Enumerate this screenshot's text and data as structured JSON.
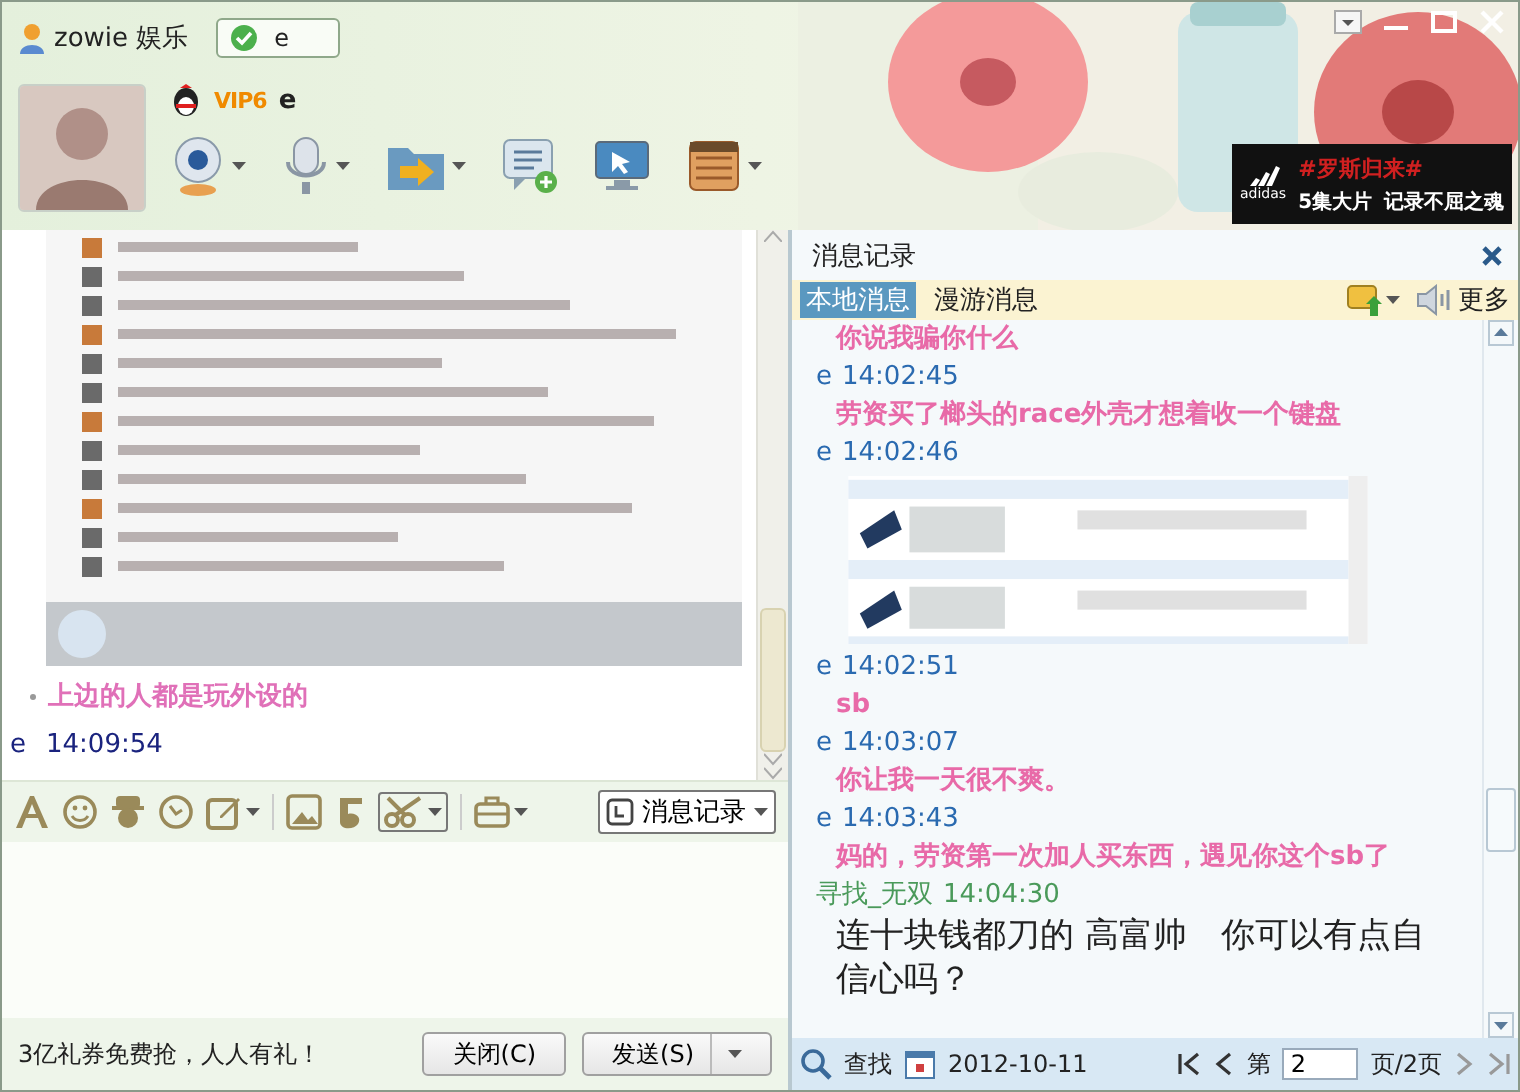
{
  "header": {
    "group_name": "zowie 娱乐",
    "status_tab": {
      "label": "e",
      "selected": true
    },
    "vip": "VIP6",
    "nickname": "e"
  },
  "ad": {
    "tag": "#罗斯归来#",
    "brand": "adidas",
    "line_1": "5集大片",
    "line_2": "记录不屈之魂"
  },
  "chat": {
    "messages": [
      {
        "kind": "picture"
      },
      {
        "kind": "text",
        "text": "上边的人都是玩外设的",
        "color": "#e070b8"
      },
      {
        "kind": "header",
        "sender": "e",
        "time": "14:09:54",
        "color": "#1a237e"
      }
    ]
  },
  "input_toolbar": {
    "history_button": "消息记录"
  },
  "footer": {
    "promo": "3亿礼券免费抢，人人有礼！",
    "buttons": [
      {
        "label": "关闭(C)",
        "kind": "plain"
      },
      {
        "label": "发送(S)",
        "kind": "split"
      }
    ]
  },
  "history": {
    "title": "消息记录",
    "tabs": [
      {
        "label": "本地消息",
        "selected": true
      },
      {
        "label": "漫游消息",
        "selected": false
      }
    ],
    "more": "更多",
    "entries": [
      {
        "kind": "text",
        "text": "你说我骗你什么",
        "color": "#e86aa8"
      },
      {
        "kind": "header",
        "sender": "e",
        "time": "14:02:45",
        "color": "#2a6ab0"
      },
      {
        "kind": "text",
        "text": "劳资买了榔头的race外壳才想着收一个键盘",
        "color": "#e86aa8"
      },
      {
        "kind": "header",
        "sender": "e",
        "time": "14:02:46",
        "color": "#2a6ab0"
      },
      {
        "kind": "picture"
      },
      {
        "kind": "header",
        "sender": "e",
        "time": "14:02:51",
        "color": "#2a6ab0"
      },
      {
        "kind": "text",
        "text": "sb",
        "color": "#e86aa8"
      },
      {
        "kind": "header",
        "sender": "e",
        "time": "14:03:07",
        "color": "#2a6ab0"
      },
      {
        "kind": "text",
        "text": "你让我一天很不爽。",
        "color": "#e86aa8"
      },
      {
        "kind": "header",
        "sender": "e",
        "time": "14:03:43",
        "color": "#2a6ab0"
      },
      {
        "kind": "text",
        "text": "妈的，劳资第一次加人买东西，遇见你这个sb了",
        "color": "#e86aa8"
      },
      {
        "kind": "header",
        "sender": "寻找_无双",
        "time": "14:04:30",
        "color": "#4a9a5a"
      },
      {
        "kind": "plain",
        "text": "连十块钱都刀的 高富帅　你可以有点自信心吗？"
      }
    ],
    "search": "查找",
    "date": "2012-10-11",
    "page_prefix": "第",
    "page": "2",
    "page_suffix": "页/2页"
  }
}
